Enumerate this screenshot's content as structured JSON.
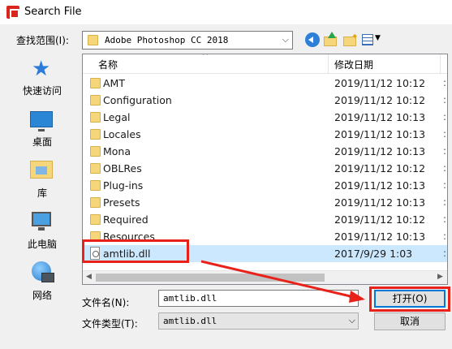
{
  "window": {
    "title": "Search File"
  },
  "toolbar": {
    "lookin_label": "查找范围(I):",
    "lookin_value": "Adobe Photoshop CC 2018"
  },
  "places": [
    {
      "label": "快速访问",
      "icon": "star-icon"
    },
    {
      "label": "桌面",
      "icon": "desktop-icon"
    },
    {
      "label": "库",
      "icon": "library-icon"
    },
    {
      "label": "此电脑",
      "icon": "computer-icon"
    },
    {
      "label": "网络",
      "icon": "network-icon"
    }
  ],
  "columns": {
    "name": "名称",
    "date": "修改日期"
  },
  "files": [
    {
      "name": "AMT",
      "date": "2019/11/12 10:12",
      "type": "folder"
    },
    {
      "name": "Configuration",
      "date": "2019/11/12 10:12",
      "type": "folder"
    },
    {
      "name": "Legal",
      "date": "2019/11/12 10:13",
      "type": "folder"
    },
    {
      "name": "Locales",
      "date": "2019/11/12 10:13",
      "type": "folder"
    },
    {
      "name": "Mona",
      "date": "2019/11/12 10:13",
      "type": "folder"
    },
    {
      "name": "OBLRes",
      "date": "2019/11/12 10:12",
      "type": "folder"
    },
    {
      "name": "Plug-ins",
      "date": "2019/11/12 10:13",
      "type": "folder"
    },
    {
      "name": "Presets",
      "date": "2019/11/12 10:13",
      "type": "folder"
    },
    {
      "name": "Required",
      "date": "2019/11/12 10:12",
      "type": "folder"
    },
    {
      "name": "Resources",
      "date": "2019/11/12 10:13",
      "type": "folder"
    },
    {
      "name": "amtlib.dll",
      "date": "2017/9/29 1:03",
      "type": "file",
      "selected": true
    }
  ],
  "footer": {
    "filename_label": "文件名(N):",
    "filename_value": "amtlib.dll",
    "filetype_label": "文件类型(T):",
    "filetype_value": "amtlib.dll",
    "open_label": "打开(O)",
    "cancel_label": "取消"
  },
  "colors": {
    "highlight": "#e8221a",
    "selection": "#cce8ff",
    "accent": "#0078d7"
  }
}
